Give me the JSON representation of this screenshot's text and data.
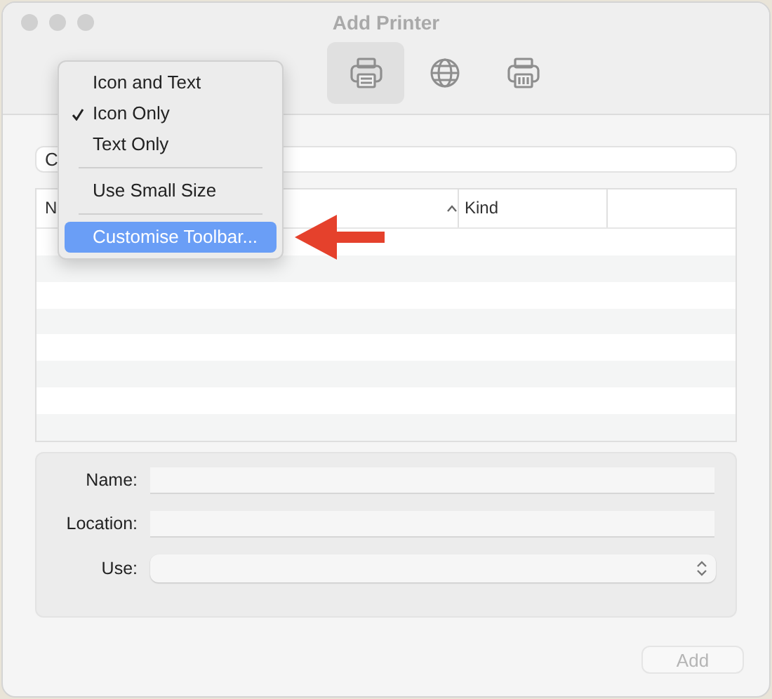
{
  "window": {
    "title": "Add Printer"
  },
  "toolbar": {
    "items": [
      {
        "kind": "printer",
        "selected": true
      },
      {
        "kind": "globe",
        "selected": false
      },
      {
        "kind": "fax",
        "selected": false
      }
    ]
  },
  "search": {
    "placeholder": "C"
  },
  "table": {
    "columns": [
      {
        "label": "N",
        "sorted": false
      },
      {
        "sorted": true
      },
      {
        "label": "Kind",
        "sorted": false
      }
    ]
  },
  "form": {
    "fields": [
      {
        "kind": "text",
        "label": "Name:"
      },
      {
        "kind": "text",
        "label": "Location:"
      },
      {
        "kind": "select",
        "label": "Use:"
      }
    ]
  },
  "buttons": [
    {
      "label": "Add",
      "disabled": true
    }
  ],
  "context_menu": {
    "items": [
      {
        "kind": "item",
        "label": "Icon and Text",
        "checked": false,
        "selected": false
      },
      {
        "kind": "item",
        "label": "Icon Only",
        "checked": true,
        "selected": false
      },
      {
        "kind": "item",
        "label": "Text Only",
        "checked": false,
        "selected": false
      },
      {
        "kind": "separator"
      },
      {
        "kind": "item",
        "label": "Use Small Size",
        "checked": false,
        "selected": false
      },
      {
        "kind": "separator"
      },
      {
        "kind": "item",
        "label": "Customise Toolbar...",
        "checked": false,
        "selected": true
      }
    ]
  }
}
